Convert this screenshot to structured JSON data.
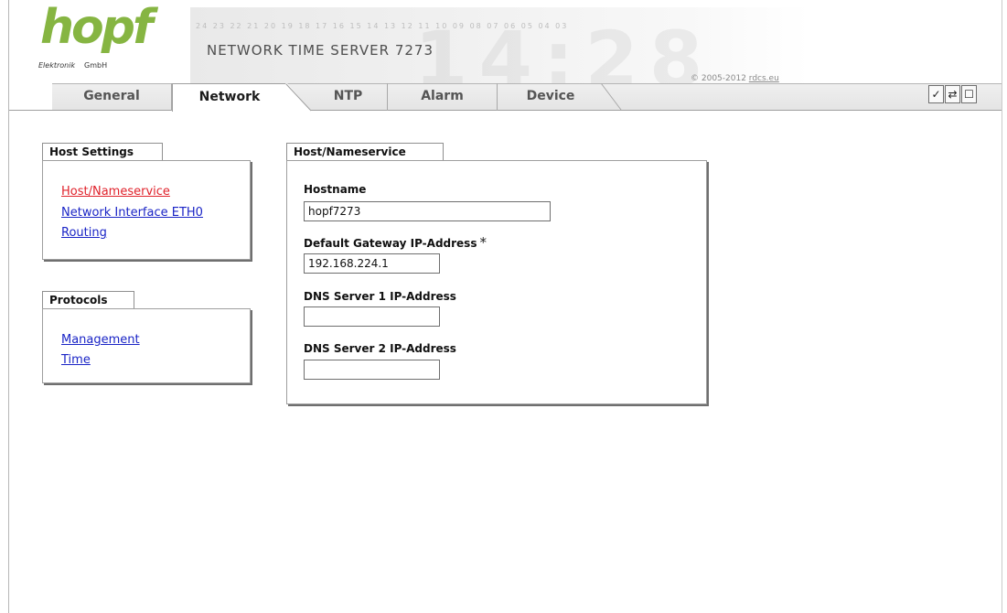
{
  "header": {
    "logo_text": "hopf",
    "logo_sub_left": "Elektronik",
    "logo_sub_right": "GmbH",
    "banner_digits": "24 23 22 21 20 19 18 17 16 15 14 13 12 11 10 09 08 07 06 05 04 03",
    "banner_clock": "14:28",
    "product_title": "NETWORK TIME SERVER 7273",
    "copyright_prefix": "© 2005-2012 ",
    "copyright_link": "rdcs.eu"
  },
  "tabs": [
    {
      "label": "General"
    },
    {
      "label": "Network"
    },
    {
      "label": "NTP"
    },
    {
      "label": "Alarm"
    },
    {
      "label": "Device"
    }
  ],
  "active_tab": "Network",
  "toolbar": {
    "apply_glyph": "✓",
    "reload_glyph": "⇄",
    "save_glyph": "☐"
  },
  "host_settings": {
    "title": "Host Settings",
    "links": [
      {
        "label": "Host/Nameservice",
        "active": true
      },
      {
        "label": "Network Interface ETH0",
        "active": false
      },
      {
        "label": "Routing",
        "active": false
      }
    ]
  },
  "protocols": {
    "title": "Protocols",
    "links": [
      {
        "label": "Management"
      },
      {
        "label": "Time"
      }
    ]
  },
  "form": {
    "title": "Host/Nameservice",
    "hostname_label": "Hostname",
    "hostname_value": "hopf7273",
    "gateway_label": "Default Gateway IP-Address",
    "gateway_required_mark": "*",
    "gateway_value": "192.168.224.1",
    "dns1_label": "DNS Server 1 IP-Address",
    "dns1_value": "",
    "dns2_label": "DNS Server 2 IP-Address",
    "dns2_value": ""
  },
  "colors": {
    "logo_green": "#86b542",
    "link_blue": "#1a24c6",
    "link_active_red": "#e0222b"
  }
}
